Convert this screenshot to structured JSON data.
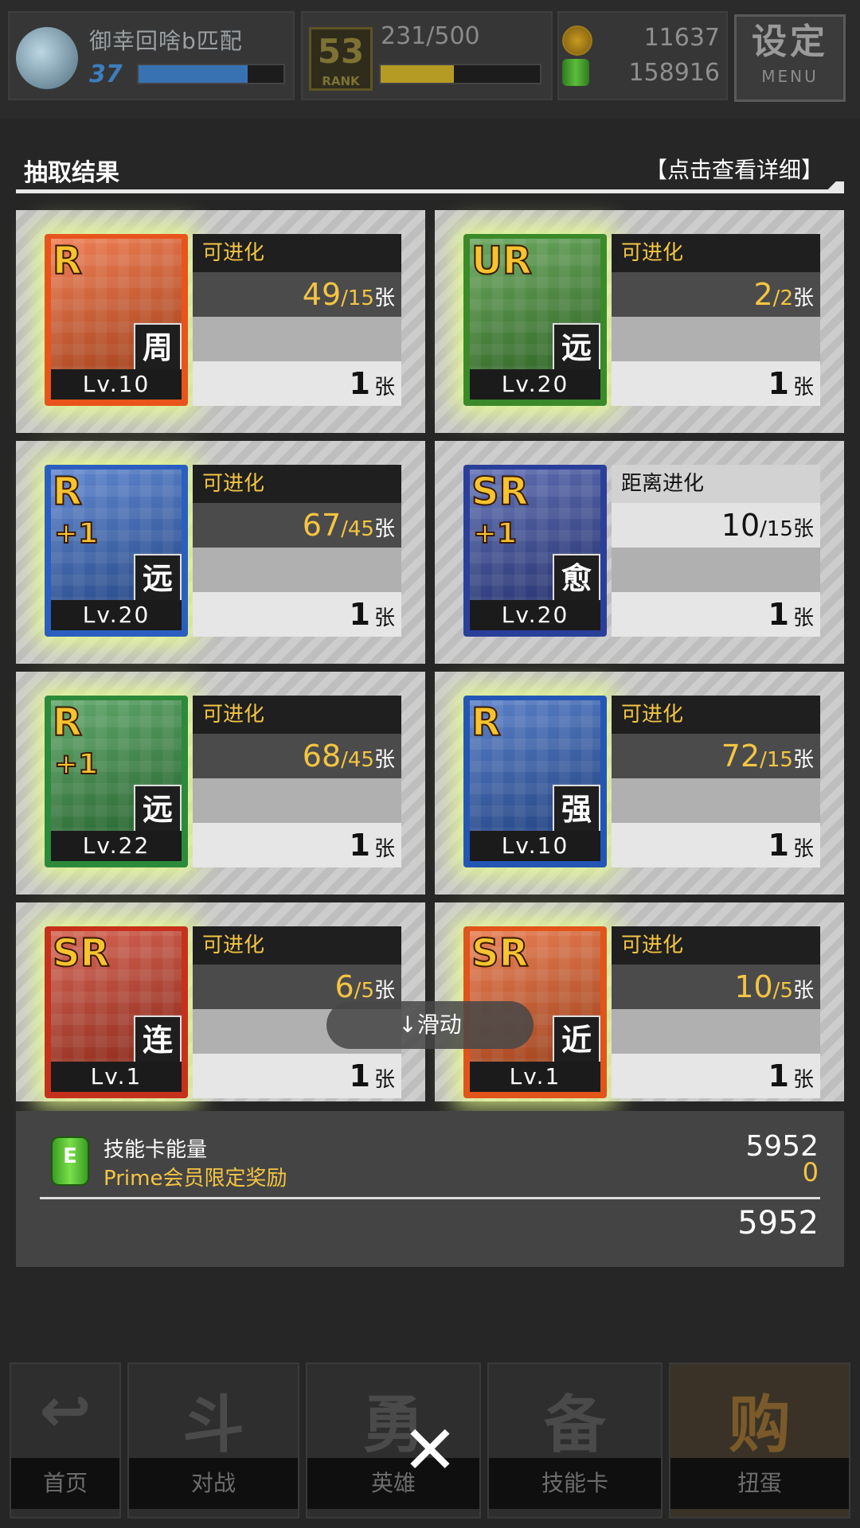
{
  "topbar": {
    "player_name": "御幸回啥b匹配",
    "level": "37",
    "level_progress": 0.75,
    "rank_number": "53",
    "rank_label": "RANK",
    "rank_progress_text": "231/500",
    "rank_progress": 0.462,
    "coins": "11637",
    "energy": "158916",
    "menu_main": "设定",
    "menu_sub": "MENU",
    "coin_icon": "coin-icon",
    "energy_icon": "energy-can-icon"
  },
  "header": {
    "title": "抽取结果",
    "detail_link": "【点击查看详细】"
  },
  "cards": [
    {
      "rarity": "R",
      "plus": "",
      "role": "周",
      "level": "Lv.10",
      "status": "可进化",
      "owned": "49",
      "sep": "/",
      "need": "15",
      "unit": "张",
      "count": "1",
      "count_unit": "张",
      "bg": "#e8541b",
      "glow": true
    },
    {
      "rarity": "UR",
      "plus": "",
      "role": "远",
      "level": "Lv.20",
      "status": "可进化",
      "owned": "2",
      "sep": "/",
      "need": "2",
      "unit": "张",
      "count": "1",
      "count_unit": "张",
      "bg": "#3a8a2a",
      "glow": true
    },
    {
      "rarity": "R",
      "plus": "+1",
      "role": "远",
      "level": "Lv.20",
      "status": "可进化",
      "owned": "67",
      "sep": "/",
      "need": "45",
      "unit": "张",
      "count": "1",
      "count_unit": "张",
      "bg": "#2b5fbf",
      "glow": true
    },
    {
      "rarity": "SR",
      "plus": "+1",
      "role": "愈",
      "level": "Lv.20",
      "status": "距离进化",
      "owned": "10",
      "sep": "/",
      "need": "15",
      "unit": "张",
      "count": "1",
      "count_unit": "张",
      "bg": "#2a3f9a",
      "glow": false
    },
    {
      "rarity": "R",
      "plus": "+1",
      "role": "远",
      "level": "Lv.22",
      "status": "可进化",
      "owned": "68",
      "sep": "/",
      "need": "45",
      "unit": "张",
      "count": "1",
      "count_unit": "张",
      "bg": "#2c8a3a",
      "glow": true
    },
    {
      "rarity": "R",
      "plus": "",
      "role": "强",
      "level": "Lv.10",
      "status": "可进化",
      "owned": "72",
      "sep": "/",
      "need": "15",
      "unit": "张",
      "count": "1",
      "count_unit": "张",
      "bg": "#2456b5",
      "glow": true
    },
    {
      "rarity": "SR",
      "plus": "",
      "role": "连",
      "level": "Lv.1",
      "status": "可进化",
      "owned": "6",
      "sep": "/",
      "need": "5",
      "unit": "张",
      "count": "1",
      "count_unit": "张",
      "bg": "#c6311b",
      "glow": true
    },
    {
      "rarity": "SR",
      "plus": "",
      "role": "近",
      "level": "Lv.1",
      "status": "可进化",
      "owned": "10",
      "sep": "/",
      "need": "5",
      "unit": "张",
      "count": "1",
      "count_unit": "张",
      "bg": "#e1541a",
      "glow": true
    }
  ],
  "swipe_hint": "↓滑动",
  "summary": {
    "label": "技能卡能量",
    "bonus_label": "Prime会员限定奖励",
    "value": "5952",
    "bonus_value": "0",
    "total": "5952"
  },
  "nav": [
    {
      "glyph": "↩",
      "label": "首页"
    },
    {
      "glyph": "斗",
      "label": "对战"
    },
    {
      "glyph": "勇",
      "label": "英雄"
    },
    {
      "glyph": "备",
      "label": "技能卡"
    },
    {
      "glyph": "购",
      "label": "扭蛋"
    }
  ],
  "close_glyph": "✕"
}
